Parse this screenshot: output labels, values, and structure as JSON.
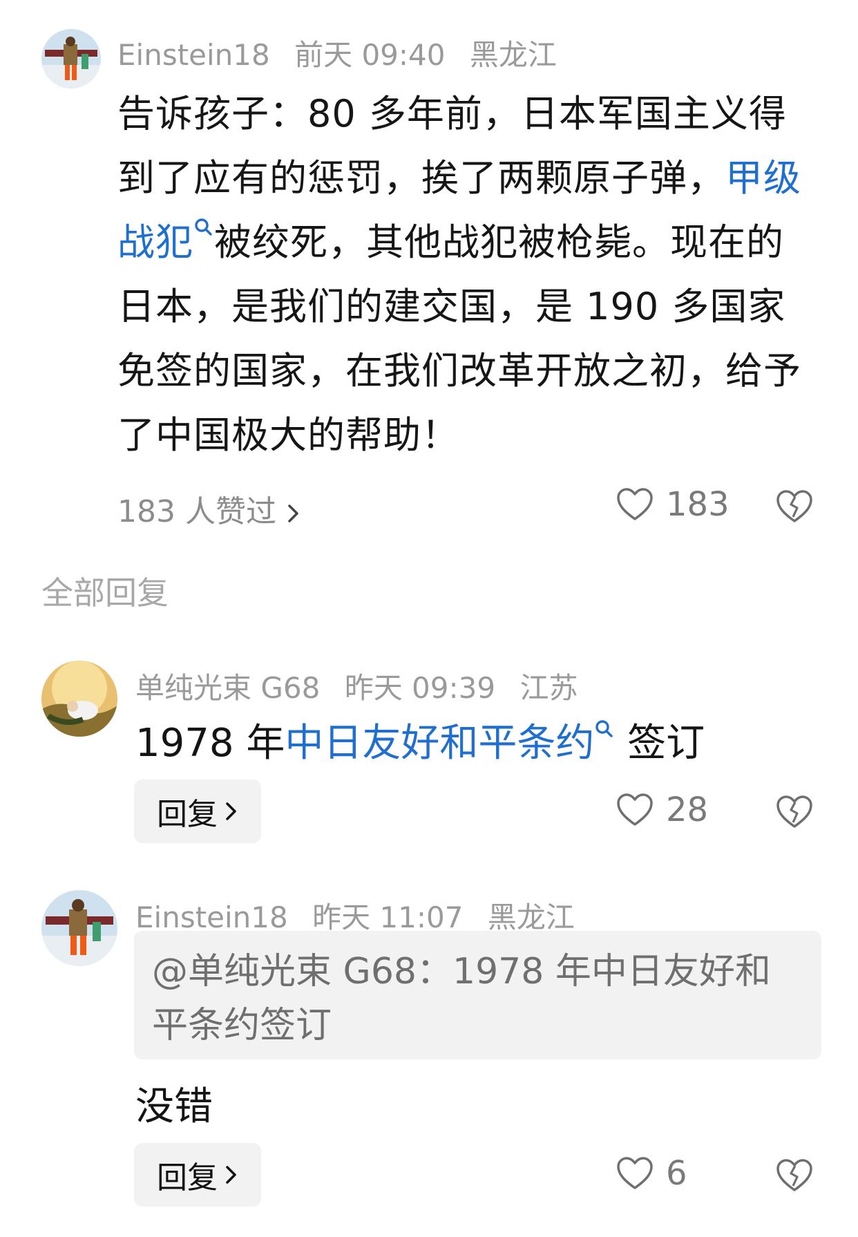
{
  "main_comment": {
    "username": "Einstein18",
    "time": "前天 09:40",
    "location": "黑龙江",
    "text_before_link": "告诉孩子：80 多年前，日本军国主义得到了应有的惩罚，挨了两颗原子弹，",
    "link_text": "甲级战犯",
    "text_after_link": "被绞死，其他战犯被枪毙。现在的日本，是我们的建交国，是 190 多国家免签的国家，在我们改革开放之初，给予了中国极大的帮助！",
    "likers_text": "183 人赞过",
    "like_count": "183"
  },
  "replies_section_title": "全部回复",
  "replies": [
    {
      "username": "单纯光束 G68",
      "time": "昨天 09:39",
      "location": "江苏",
      "text_before_link": "1978 年",
      "link_text": "中日友好和平条约",
      "text_after_link": "签订",
      "reply_label": "回复",
      "like_count": "28"
    },
    {
      "username": "Einstein18",
      "time": "昨天 11:07",
      "location": "黑龙江",
      "quote": "@单纯光束 G68：1978 年中日友好和平条约签订",
      "text": "没错",
      "reply_label": "回复",
      "like_count": "6"
    }
  ],
  "colors": {
    "link": "#1f6fd0",
    "meta": "#9a9a9a",
    "reply_bg": "#f2f2f2"
  }
}
